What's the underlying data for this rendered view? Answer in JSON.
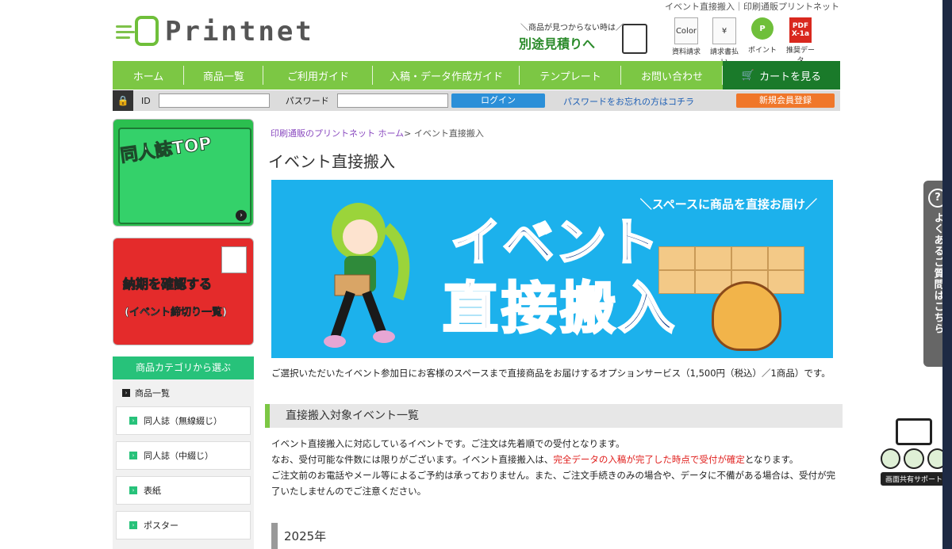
{
  "header": {
    "top_link": "イベント直接搬入｜印刷通販プリントネット",
    "logo_text": "Printnet",
    "estimate_small": "＼商品が見つからない時は／",
    "estimate_big": "別途見積りへ",
    "icons": [
      {
        "label": "資料請求",
        "glyph": "Color"
      },
      {
        "label": "請求書払い",
        "glyph": "¥"
      },
      {
        "label": "ポイント",
        "glyph": "P"
      },
      {
        "label": "推奨データ",
        "glyph": "PDF X-1a"
      }
    ]
  },
  "nav": {
    "items": [
      "ホーム",
      "商品一覧",
      "ご利用ガイド",
      "入稿・データ作成ガイド",
      "テンプレート",
      "お問い合わせ"
    ],
    "cart": "カートを見る"
  },
  "login": {
    "id_label": "ID",
    "password_label": "パスワード",
    "login_button": "ログイン",
    "forgot": "パスワードをお忘れの方はコチラ",
    "register": "新規会員登録"
  },
  "sidebar": {
    "banner1_title": "同人誌TOP",
    "banner2_line1": "納期を確認する",
    "banner2_line2": "(イベント締切り一覧)",
    "category_button": "商品カテゴリから選ぶ",
    "category_head": "商品一覧",
    "categories": [
      "同人誌（無線綴じ）",
      "同人誌（中綴じ）",
      "表紙",
      "ポスター"
    ]
  },
  "main": {
    "breadcrumb_home": "印刷通販のプリントネット ホーム",
    "breadcrumb_sep": ">",
    "breadcrumb_current": "イベント直接搬入",
    "title": "イベント直接搬入",
    "hero_sub": "＼スペースに商品を直接お届け／",
    "hero_line1": "イベント",
    "hero_line2": "直接搬入",
    "description": "ご選択いただいたイベント参加日にお客様のスペースまで直接商品をお届けするオプションサービス（1,500円（税込）／1商品）です。",
    "section_title": "直接搬入対象イベント一覧",
    "para_line1": "イベント直接搬入に対応しているイベントです。ご注文は先着順での受付となります。",
    "para_line2_a": "なお、受付可能な件数には限りがございます。イベント直接搬入は、",
    "para_line2_red": "完全データの入稿が完了した時点で受付が確定",
    "para_line2_b": "となります。",
    "para_line3": "ご注文前のお電話やメール等によるご予約は承っておりません。また、ご注文手続きのみの場合や、データに不備がある場合は、受付が完了いたしませんのでご注意ください。",
    "year": "2025年"
  },
  "floating": {
    "faq_q": "?",
    "faq_text": "よくあるご質問はこちら",
    "share_label": "画面共有サポート"
  },
  "colors": {
    "nav_green": "#7cc744",
    "cart_green": "#1a7a2a",
    "login_blue": "#2b8fd8",
    "register_orange": "#f0772a",
    "hero_blue": "#1cb1ec"
  }
}
